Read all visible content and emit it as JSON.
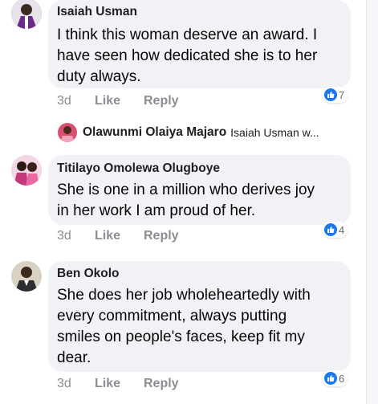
{
  "comments": [
    {
      "author": "Isaiah Usman",
      "text": "I think this woman deserve an award. I\nhave seen how dedicated she is to her\nduty always.",
      "time": "3d",
      "like_label": "Like",
      "reply_label": "Reply",
      "reaction_icon": "like-icon",
      "reaction_count": "7"
    },
    {
      "author": "Titilayo Omolewa Olugboye",
      "text": "She is one in a million who derives joy\nin her work I am proud of her.",
      "time": "3d",
      "like_label": "Like",
      "reply_label": "Reply",
      "reaction_icon": "like-icon",
      "reaction_count": "4"
    },
    {
      "author": "Ben Okolo",
      "text": "She does her job wholeheartedly with\nevery commitment, always putting\nsmiles on people's faces, keep fit my\ndear.",
      "time": "3d",
      "like_label": "Like",
      "reply_label": "Reply",
      "reaction_icon": "like-icon",
      "reaction_count": "6"
    }
  ],
  "reply_preview": {
    "author": "Olawunmi Olaiya Majaro",
    "snippet": "Isaiah Usman  w..."
  },
  "colors": {
    "bubble": "#f0f2f5",
    "like_blue": "#1877f2",
    "meta_gray": "#8a8d91"
  }
}
